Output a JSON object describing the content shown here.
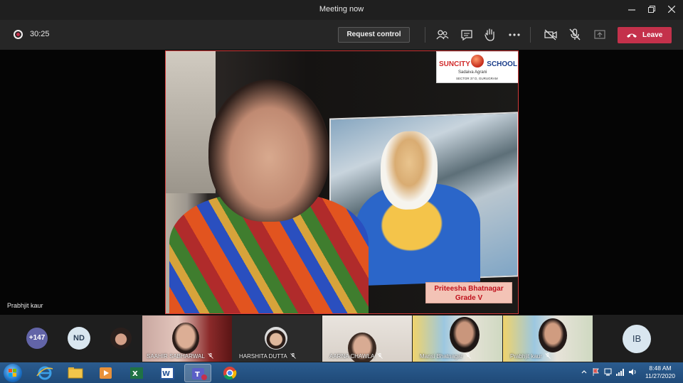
{
  "window": {
    "title": "Meeting now"
  },
  "toolbar": {
    "timer": "30:25",
    "request_control_label": "Request control",
    "leave_label": "Leave",
    "colors": {
      "leave": "#c4314b",
      "record": "#c4314b"
    }
  },
  "stage": {
    "speaker_name": "Prabhjit kaur",
    "school_logo": {
      "name_part1": "SUNCITY",
      "name_part2": "SCHOOL",
      "tagline": "Sadaiva Agrani",
      "sector": "SECTOR 37 D, GURUGRAM"
    },
    "caption": {
      "line1": "Priteesha Bhatnagar",
      "line2": "Grade V"
    }
  },
  "participants": {
    "overflow_count": "+147",
    "initials_left": "ND",
    "initials_right": "IB",
    "tiles": [
      {
        "name": "SAAHIR SABHARWAL"
      },
      {
        "name": "HARSHITA DUTTA"
      },
      {
        "name": "AARNA CHAWLA"
      },
      {
        "name": "Mansi Bhatnagar"
      },
      {
        "name": "Prabhjit kaur"
      }
    ]
  },
  "taskbar": {
    "time": "8:48 AM",
    "date": "11/27/2020"
  }
}
